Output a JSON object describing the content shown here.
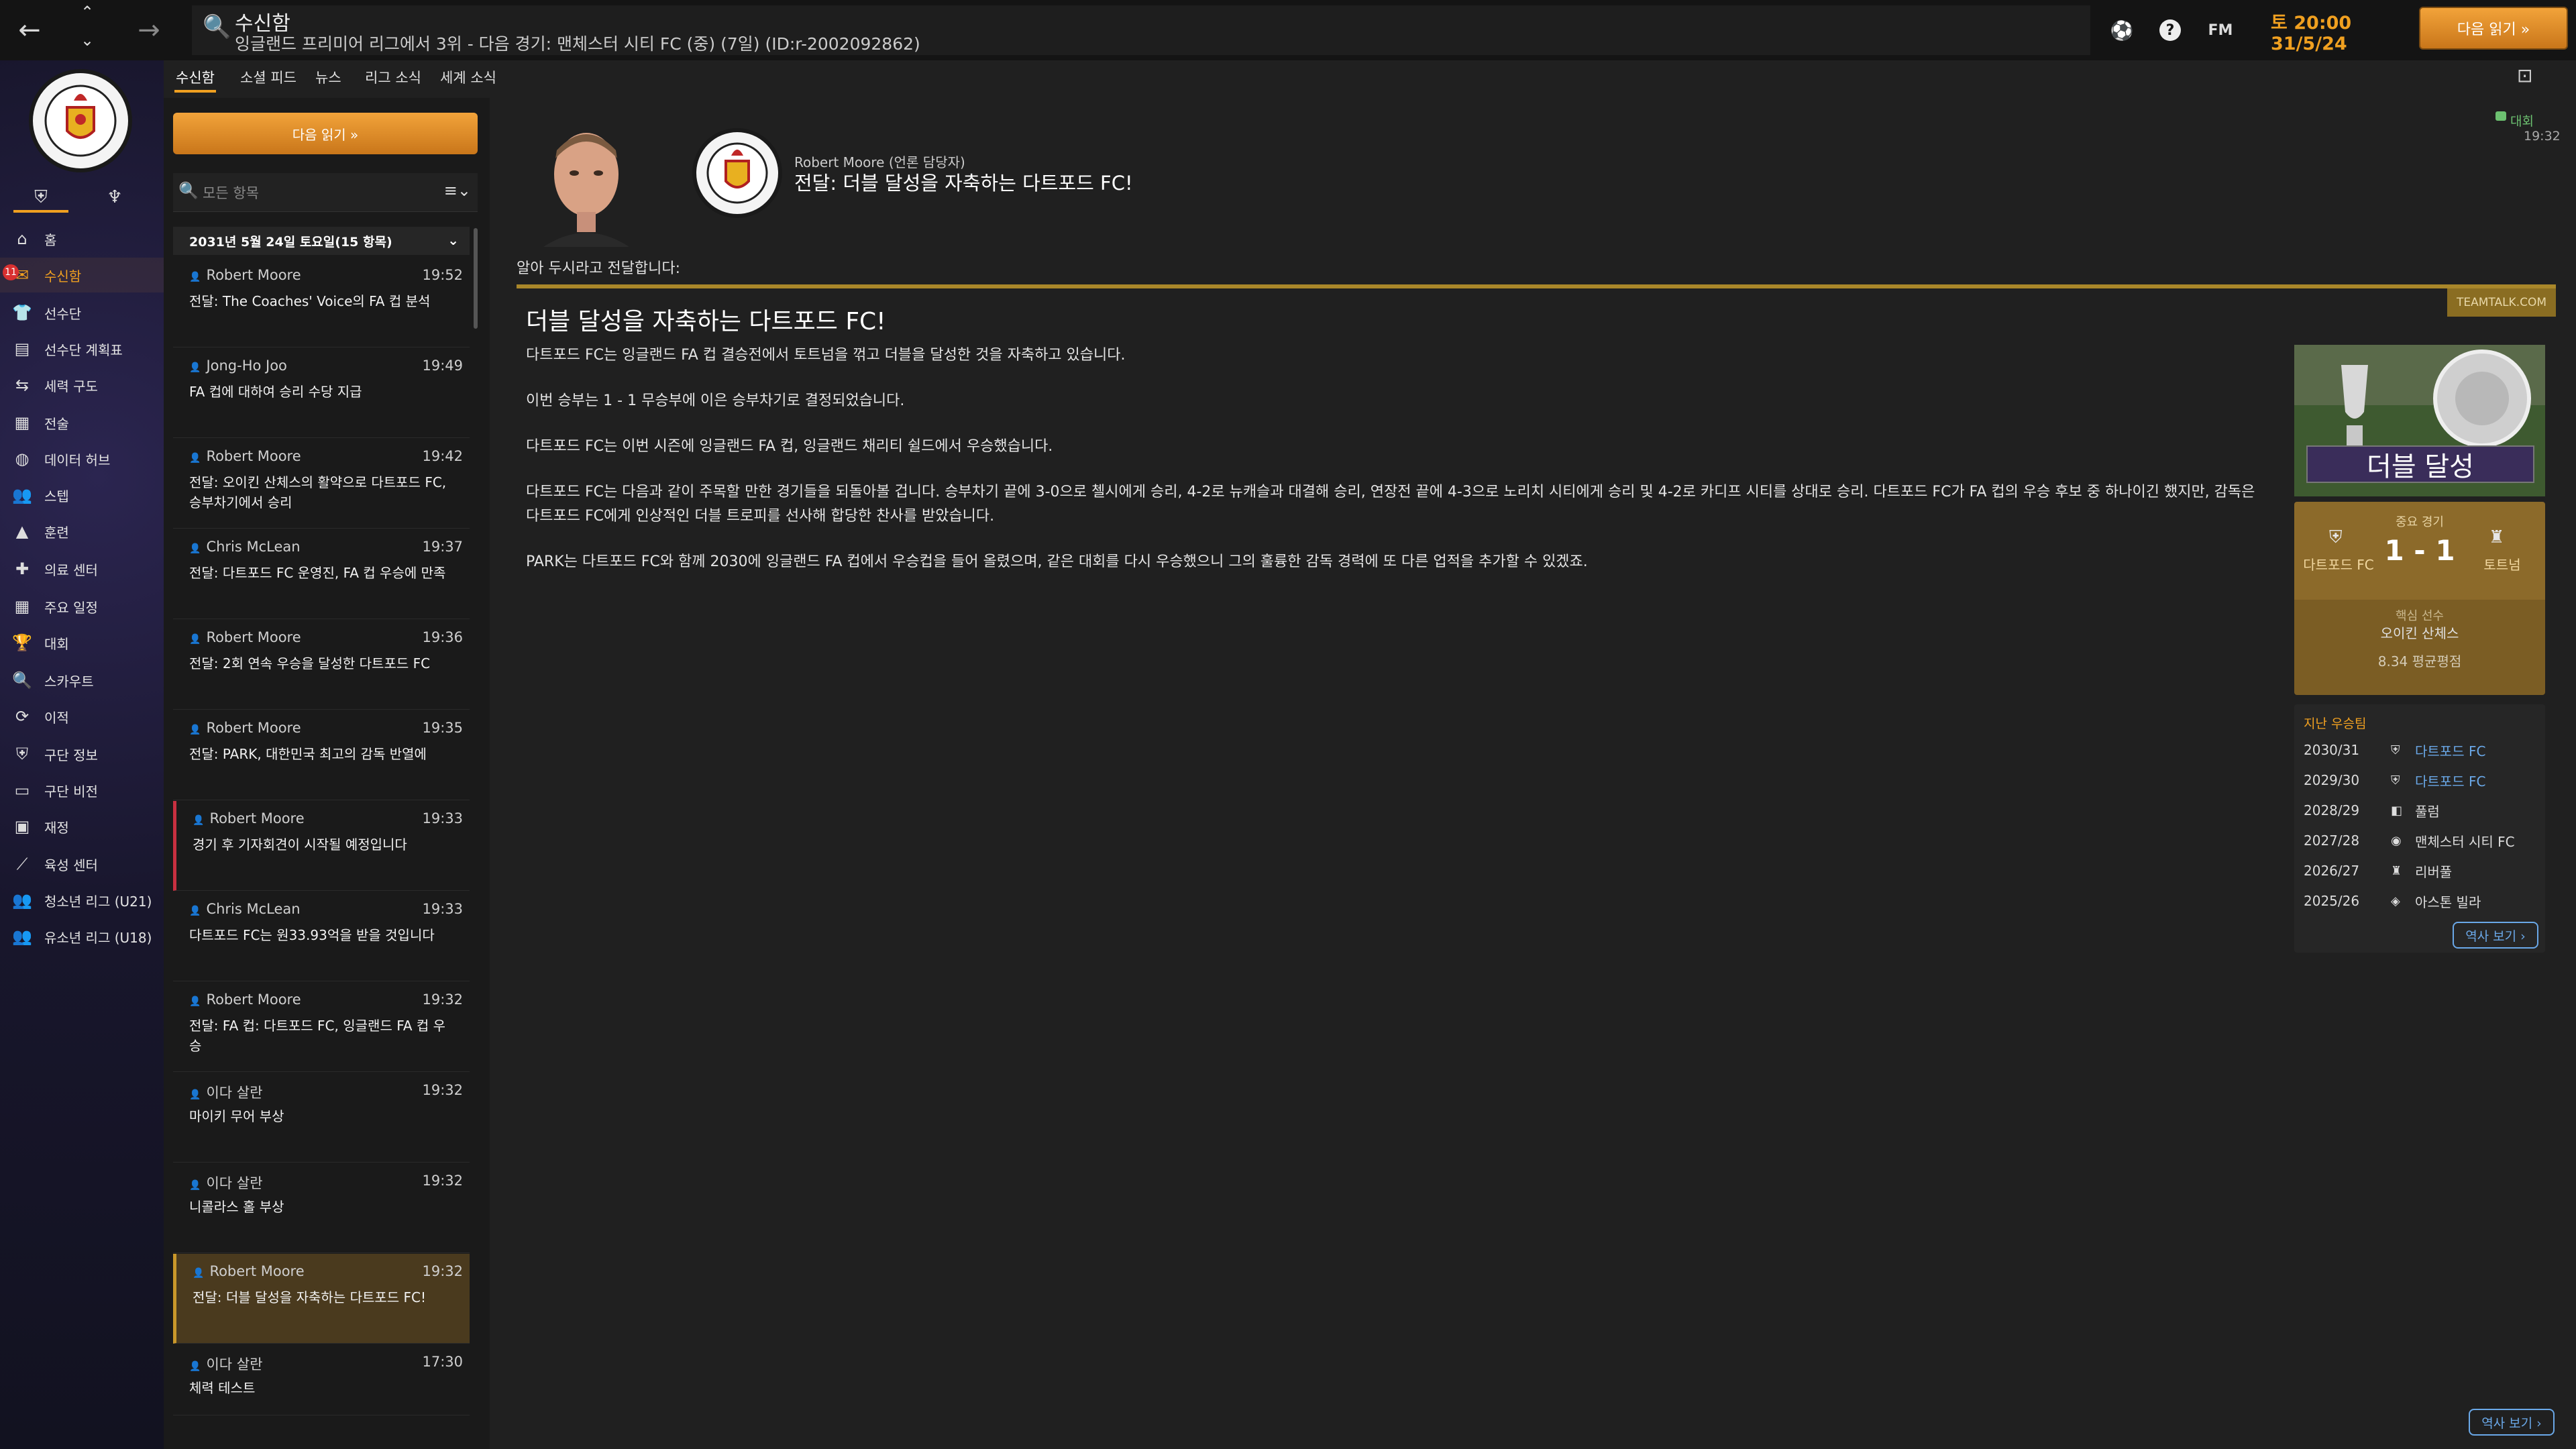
{
  "topbar": {
    "title": "수신함",
    "breadcrumb": "잉글랜드 프리미어 리그에서 3위 - 다음 경기: 맨체스터 시티 FC (중) (7일) (ID:r-2002092862)",
    "fm_label": "FM",
    "date_line1": "토 20:00",
    "date_line2": "31/5/24",
    "continue_label": "다음 읽기 »"
  },
  "sidebar": {
    "items": [
      {
        "label": "홈",
        "icon": "home-icon"
      },
      {
        "label": "수신함",
        "icon": "inbox-icon",
        "badge": "11"
      },
      {
        "label": "선수단",
        "icon": "squad-icon"
      },
      {
        "label": "선수단 계획표",
        "icon": "plan-icon"
      },
      {
        "label": "세력 구도",
        "icon": "dynamics-icon"
      },
      {
        "label": "전술",
        "icon": "tactics-icon"
      },
      {
        "label": "데이터 허브",
        "icon": "data-icon"
      },
      {
        "label": "스텝",
        "icon": "staff-icon"
      },
      {
        "label": "훈련",
        "icon": "training-icon"
      },
      {
        "label": "의료 센터",
        "icon": "medical-icon"
      },
      {
        "label": "주요 일정",
        "icon": "calendar-icon"
      },
      {
        "label": "대회",
        "icon": "trophy-icon"
      },
      {
        "label": "스카우트",
        "icon": "scout-icon"
      },
      {
        "label": "이적",
        "icon": "transfer-icon"
      },
      {
        "label": "구단 정보",
        "icon": "club-info-icon"
      },
      {
        "label": "구단 비전",
        "icon": "vision-icon"
      },
      {
        "label": "재정",
        "icon": "finance-icon"
      },
      {
        "label": "육성 센터",
        "icon": "development-icon"
      },
      {
        "label": "청소년 리그 (U21)",
        "icon": "u21-icon"
      },
      {
        "label": "유소년 리그 (U18)",
        "icon": "u18-icon"
      }
    ]
  },
  "tabs": [
    "수신함",
    "소셜 피드",
    "뉴스",
    "리그 소식",
    "세계 소식"
  ],
  "list": {
    "continue_label": "다음 읽기 »",
    "search_placeholder": "모든 항목",
    "date_header": "2031년 5월 24일 토요일(15 항목)",
    "messages": [
      {
        "sender": "Robert Moore",
        "time": "19:52",
        "subject": "전달: The Coaches' Voice의 FA 컵 분석"
      },
      {
        "sender": "Jong-Ho Joo",
        "time": "19:49",
        "subject": "FA 컵에 대하여 승리 수당 지급"
      },
      {
        "sender": "Robert Moore",
        "time": "19:42",
        "subject": "전달: 오이킨 산체스의 활약으로 다트포드 FC, 승부차기에서 승리"
      },
      {
        "sender": "Chris McLean",
        "time": "19:37",
        "subject": "전달: 다트포드 FC 운영진, FA 컵 우승에 만족"
      },
      {
        "sender": "Robert Moore",
        "time": "19:36",
        "subject": "전달: 2회 연속 우승을 달성한 다트포드 FC"
      },
      {
        "sender": "Robert Moore",
        "time": "19:35",
        "subject": "전달: PARK, 대한민국 최고의 감독 반열에"
      },
      {
        "sender": "Robert Moore",
        "time": "19:33",
        "subject": "경기 후 기자회견이 시작될 예정입니다"
      },
      {
        "sender": "Chris McLean",
        "time": "19:33",
        "subject": "다트포드 FC는 원33.93억을 받을 것입니다"
      },
      {
        "sender": "Robert Moore",
        "time": "19:32",
        "subject": "전달: FA 컵: 다트포드 FC, 잉글랜드 FA 컵 우승"
      },
      {
        "sender": "이다 살란",
        "time": "19:32",
        "subject": "마이키 무어 부상"
      },
      {
        "sender": "이다 살란",
        "time": "19:32",
        "subject": "니콜라스 홀 부상"
      },
      {
        "sender": "Robert Moore",
        "time": "19:32",
        "subject": "전달: 더블 달성을 자축하는 다트포드 FC!"
      },
      {
        "sender": "이다 살란",
        "time": "17:30",
        "subject": "체력 테스트"
      }
    ]
  },
  "article": {
    "sender": "Robert Moore (언론 담당자)",
    "subject": "전달: 더블 달성을 자축하는 다트포드 FC!",
    "tag": "대회",
    "tag_time": "19:32",
    "intro": "알아 두시라고 전달합니다:",
    "source": "TEAMTALK.COM",
    "title": "더블 달성을 자축하는 다트포드 FC!",
    "paragraphs": [
      "다트포드 FC는 잉글랜드 FA 컵 결승전에서 토트넘을 꺾고 더블을 달성한 것을 자축하고 있습니다.",
      "이번 승부는 1 - 1 무승부에 이은 승부차기로 결정되었습니다.",
      "다트포드 FC는 이번 시즌에 잉글랜드 FA 컵, 잉글랜드 채리티 쉴드에서 우승했습니다.",
      "다트포드 FC는 다음과 같이 주목할 만한 경기들을 되돌아볼 겁니다. 승부차기 끝에 3-0으로 첼시에게 승리, 4-2로 뉴캐슬과 대결해 승리, 연장전 끝에 4-3으로 노리치 시티에게 승리 및 4-2로 카디프 시티를 상대로 승리. 다트포드 FC가 FA 컵의 우승 후보 중 하나이긴 했지만, 감독은 다트포드 FC에게 인상적인 더블 트로피를 선사해 합당한 찬사를 받았습니다.",
      "PARK는 다트포드 FC와 함께 2030에 잉글랜드 FA 컵에서 우승컵을 들어 올렸으며, 같은 대회를 다시 우승했으니 그의 훌륭한 감독 경력에 또 다른 업적을 추가할 수 있겠죠."
    ]
  },
  "panel": {
    "double_label": "더블 달성",
    "match_label": "중요 경기",
    "home": "다트포드 FC",
    "away": "토트넘",
    "score": "1 - 1",
    "key_player_label": "핵심 선수",
    "key_player": "오이킨 산체스",
    "rating": "8.34 평균평점",
    "prev_header": "지난 우승팀",
    "prev_winners": [
      {
        "season": "2030/31",
        "club": "다트포드 FC"
      },
      {
        "season": "2029/30",
        "club": "다트포드 FC"
      },
      {
        "season": "2028/29",
        "club": "풀럼"
      },
      {
        "season": "2027/28",
        "club": "맨체스터 시티 FC"
      },
      {
        "season": "2026/27",
        "club": "리버풀"
      },
      {
        "season": "2025/26",
        "club": "아스톤 빌라"
      }
    ],
    "history_button": "역사 보기 ›",
    "history_button_bottom": "역사 보기 ›"
  }
}
